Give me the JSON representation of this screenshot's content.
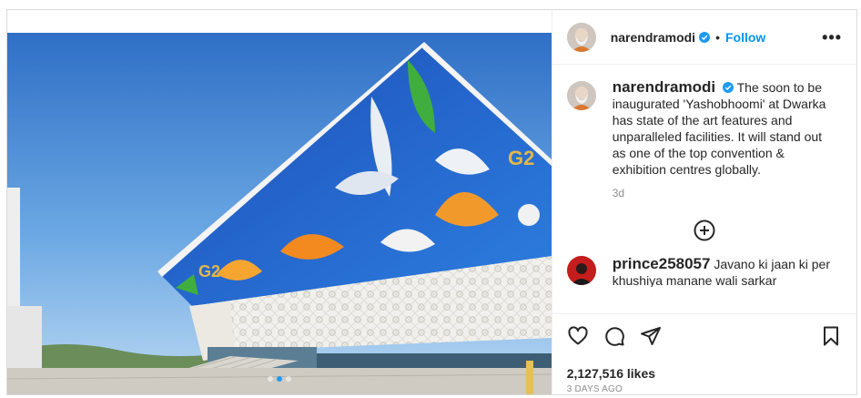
{
  "post": {
    "username": "narendramodi",
    "follow_label": "Follow",
    "separator": "•",
    "more_label": "•••",
    "caption": "The soon to be inaugurated 'Yashobhoomi' at Dwarka has state of the art features and unparalleled facilities. It will stand out as one of the top convention & exhibition centres globally.",
    "caption_age": "3d",
    "likes": "2,127,516 likes",
    "date": "3 DAYS AGO",
    "carousel": {
      "count": 3,
      "active": 1
    }
  },
  "comments": [
    {
      "username": "prince258057",
      "text": "Javano ki jaan ki per khushiya manane wali sarkar"
    }
  ],
  "icons": {
    "verified": "verified-badge-icon",
    "more": "more-options-icon",
    "load_more": "plus-circle-icon",
    "like": "heart-icon",
    "comment": "comment-icon",
    "share": "share-icon",
    "save": "bookmark-icon"
  },
  "colors": {
    "accent": "#0095f6",
    "verified": "#1e9bf0",
    "text": "#262626",
    "muted": "#8e8e8e"
  }
}
